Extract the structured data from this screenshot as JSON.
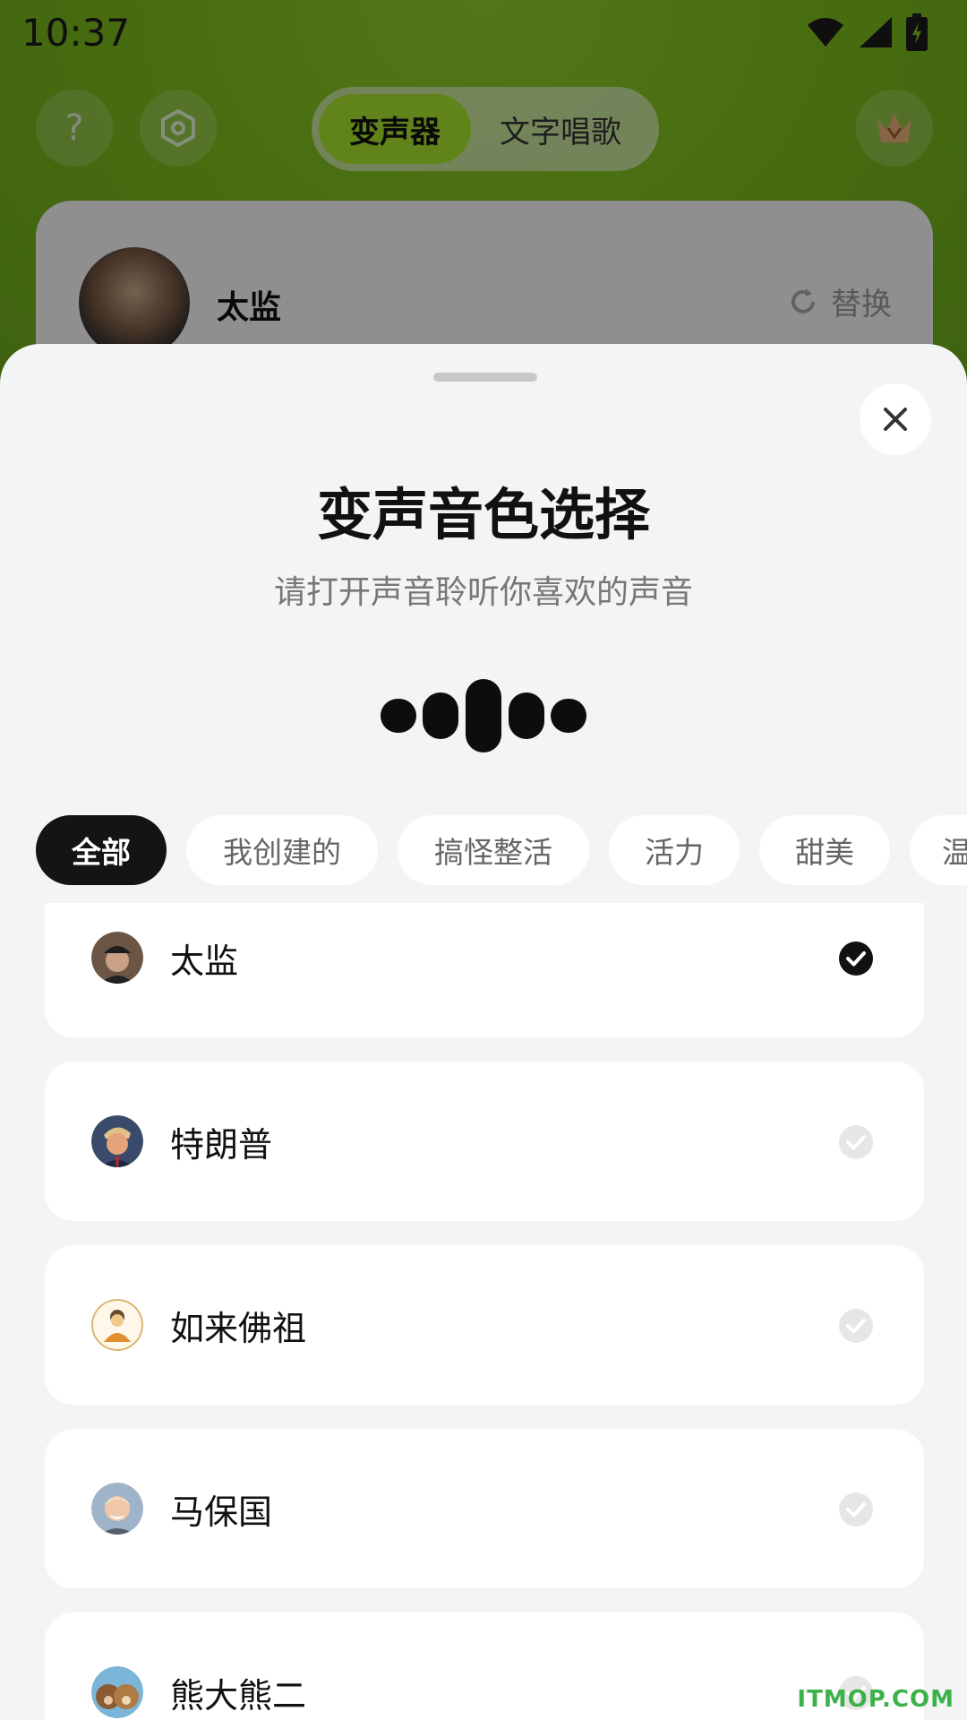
{
  "status": {
    "time": "10:37"
  },
  "background_app": {
    "segment": {
      "active": "变声器",
      "inactive": "文字唱歌"
    },
    "help_icon_glyph": "?",
    "current_voice": {
      "name": "太监",
      "replace_label": "替换"
    }
  },
  "sheet": {
    "title": "变声音色选择",
    "subtitle": "请打开声音聆听你喜欢的声音",
    "categories": [
      "全部",
      "我创建的",
      "搞怪整活",
      "活力",
      "甜美",
      "温"
    ],
    "selected_category": "全部",
    "voices": [
      {
        "name": "太监",
        "selected": true,
        "avatar_icon": "eunuch-avatar-icon"
      },
      {
        "name": "特朗普",
        "selected": false,
        "avatar_icon": "trump-avatar-icon"
      },
      {
        "name": "如来佛祖",
        "selected": false,
        "avatar_icon": "buddha-avatar-icon"
      },
      {
        "name": "马保国",
        "selected": false,
        "avatar_icon": "old-man-avatar-icon"
      },
      {
        "name": "熊大熊二",
        "selected": false,
        "avatar_icon": "bears-avatar-icon"
      }
    ]
  },
  "watermark": "ITMOP.COM",
  "colors": {
    "accent_green": "#a6e22e",
    "sheet_bg": "#f3f4f6",
    "chip_active": "#141414",
    "watermark": "#3cb34a"
  }
}
